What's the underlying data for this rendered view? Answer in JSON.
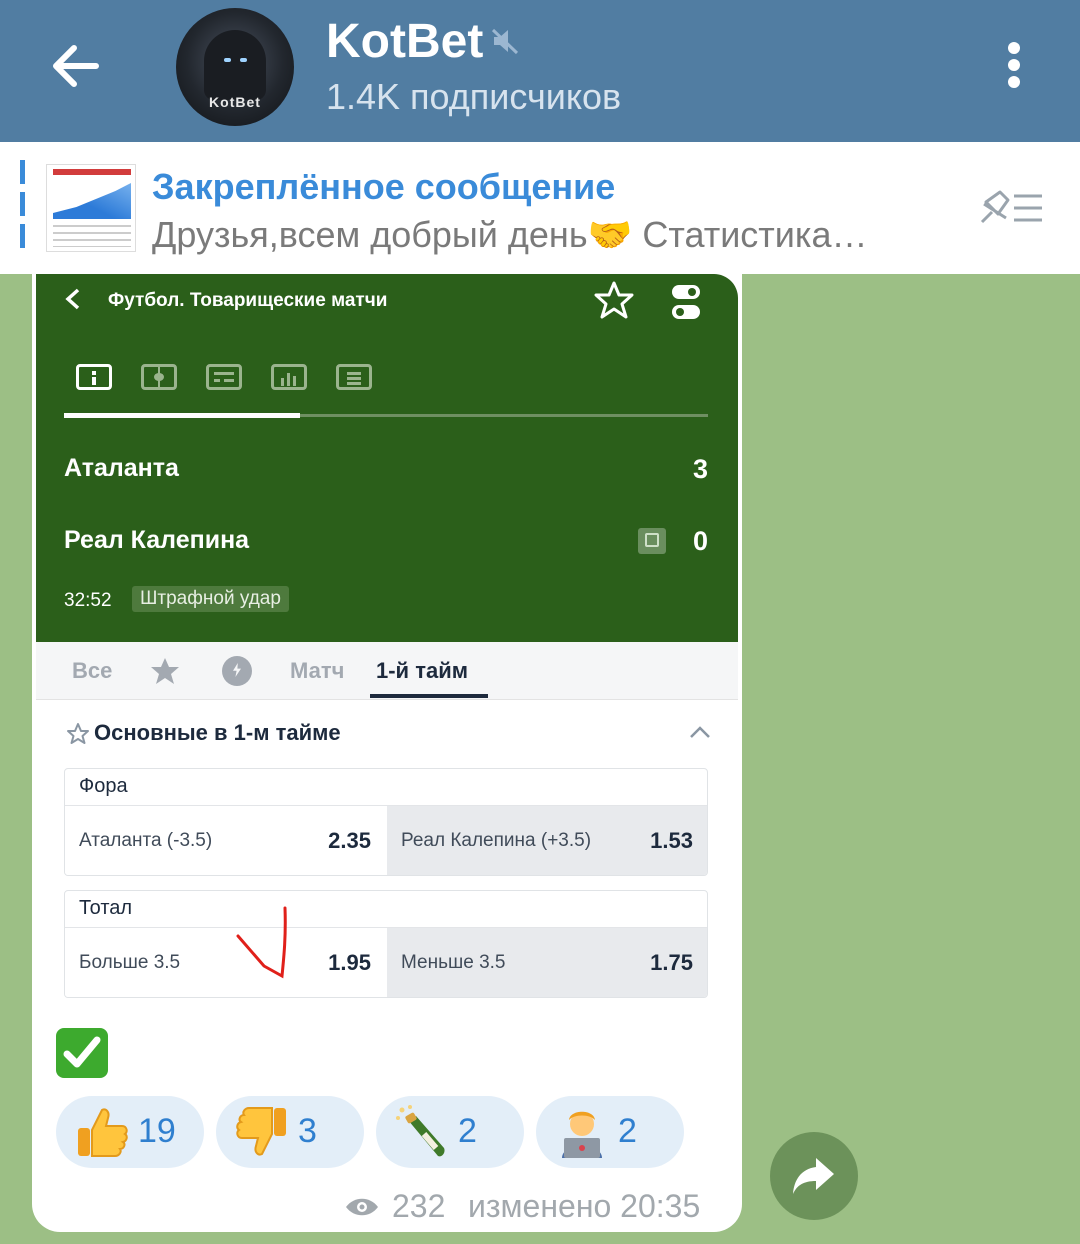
{
  "header": {
    "title": "KotBet",
    "subscribers": "1.4K подписчиков",
    "avatar_label": "KotBet"
  },
  "pinned": {
    "title": "Закреплённое сообщение",
    "text": "Друзья,всем добрый день🤝  Статистика…"
  },
  "screenshot": {
    "league": "Футбол. Товарищеские матчи",
    "team1": {
      "name": "Аталанта",
      "score": "3"
    },
    "team2": {
      "name": "Реал Калепина",
      "score": "0"
    },
    "time": "32:52",
    "event": "Штрафной удар",
    "subtabs": {
      "all": "Все",
      "match": "Матч",
      "first_half": "1-й тайм"
    },
    "section_title": "Основные в 1-м тайме",
    "markets": [
      {
        "title": "Фора",
        "left": {
          "name": "Аталанта (-3.5)",
          "odd": "2.35"
        },
        "right": {
          "name": "Реал Калепина (+3.5)",
          "odd": "1.53"
        }
      },
      {
        "title": "Тотал",
        "left": {
          "name": "Больше 3.5",
          "odd": "1.95"
        },
        "right": {
          "name": "Меньше 3.5",
          "odd": "1.75"
        }
      }
    ],
    "colors": {
      "header_green": "#2b5f1a",
      "tick_red": "#e0201a"
    }
  },
  "message": {
    "check_emoji": "check-mark-button",
    "reactions": [
      {
        "emoji": "thumbs-up",
        "count": "19"
      },
      {
        "emoji": "thumbs-down",
        "count": "3"
      },
      {
        "emoji": "champagne-bottle",
        "count": "2"
      },
      {
        "emoji": "technologist",
        "count": "2"
      }
    ],
    "views": "232",
    "edited": "изменено 20:35"
  },
  "colors": {
    "header_blue": "#517da2",
    "link_blue": "#3a8bd9",
    "chat_bg": "#9cbf85"
  }
}
